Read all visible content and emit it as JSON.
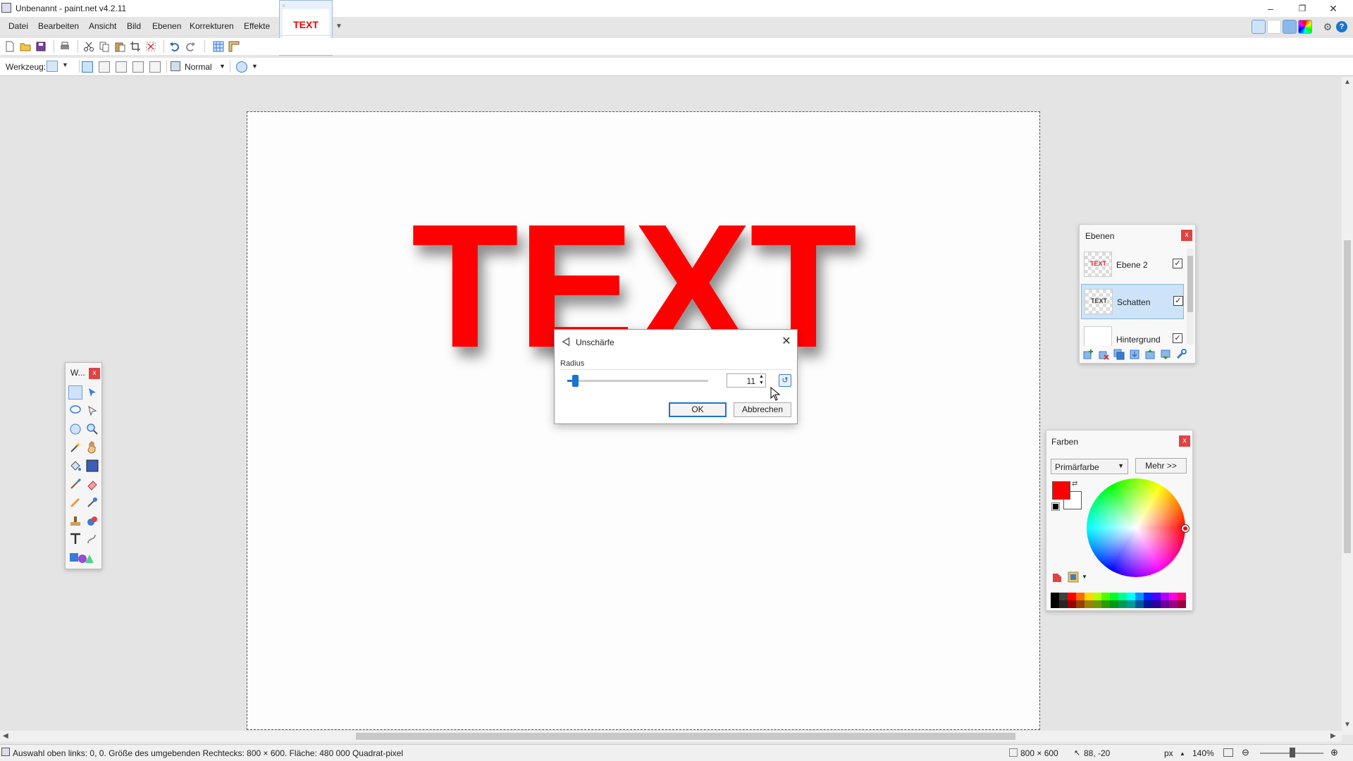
{
  "window": {
    "title": "Unbenannt - paint.net v4.2.11",
    "minimize": "–",
    "restore": "❐",
    "close": "✕"
  },
  "menu": [
    "Datei",
    "Bearbeiten",
    "Ansicht",
    "Bild",
    "Ebenen",
    "Korrekturen",
    "Effekte"
  ],
  "image_tab": {
    "thumbnail_text": "TEXT",
    "close": "×"
  },
  "toolbar": {
    "tool_label": "Werkzeug:",
    "blend_mode": "Normal"
  },
  "canvas": {
    "text": "TEXT",
    "text_color": "#ff0000"
  },
  "tools_window": {
    "title": "W...",
    "close": "x"
  },
  "layers_window": {
    "title": "Ebenen",
    "close": "x",
    "layers": [
      {
        "name": "Ebene 2",
        "thumb": "TEXT",
        "visible": "✓"
      },
      {
        "name": "Schatten",
        "thumb": "TEXT",
        "visible": "✓"
      },
      {
        "name": "Hintergrund",
        "thumb": "",
        "visible": "✓"
      }
    ]
  },
  "colors_window": {
    "title": "Farben",
    "close": "x",
    "selector_value": "Primärfarbe",
    "more_label": "Mehr >>",
    "primary_color": "#ff0000",
    "secondary_color": "#ffffff",
    "palette": [
      "#000000",
      "#404040",
      "#ff0000",
      "#ff6a00",
      "#ffd800",
      "#b6ff00",
      "#4cff00",
      "#00ff21",
      "#00ff90",
      "#00ffff",
      "#0094ff",
      "#0026ff",
      "#4800ff",
      "#b200ff",
      "#ff00dc",
      "#ff006e"
    ]
  },
  "blur_dialog": {
    "title": "Unschärfe",
    "close": "✕",
    "radius_label": "Radius",
    "radius_value": "11",
    "radius_fraction": 0.055,
    "reset": "↺",
    "ok_label": "OK",
    "cancel_label": "Abbrechen"
  },
  "status": {
    "selection_info": "Auswahl oben links: 0, 0. Größe des umgebenden Rechtecks: 800 × 600. Fläche: 480 000 Quadrat-pixel",
    "image_size": "800 × 600",
    "cursor_pos": "88, -20",
    "units": "px",
    "zoom": "140%"
  }
}
